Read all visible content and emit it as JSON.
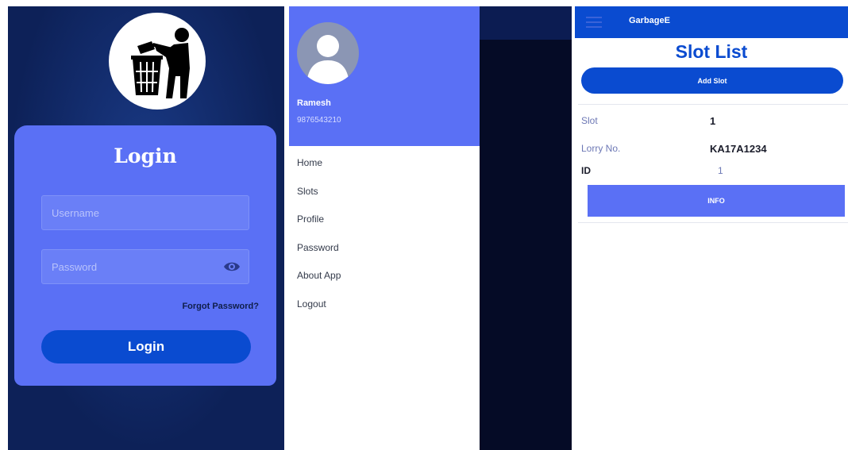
{
  "login": {
    "title": "Login",
    "username_placeholder": "Username",
    "password_placeholder": "Password",
    "forgot_password": "Forgot Password?",
    "login_button": "Login",
    "logo_icon": "trash-bin-person-icon",
    "password_toggle_icon": "eye-icon"
  },
  "drawer": {
    "user_name": "Ramesh",
    "user_phone": "9876543210",
    "avatar_icon": "user-avatar-icon",
    "menu_items": [
      "Home",
      "Slots",
      "Profile",
      "Password",
      "About App",
      "Logout"
    ]
  },
  "slot_list": {
    "app_title": "GarbageE",
    "page_title": "Slot List",
    "add_button": "Add Slot",
    "menu_icon": "hamburger-menu-icon",
    "slot": {
      "slot_label": "Slot",
      "slot_value": "1",
      "lorry_label": "Lorry No.",
      "lorry_value": "KA17A1234",
      "id_label": "ID",
      "id_value": "1",
      "info_button": "INFO"
    }
  },
  "colors": {
    "navy": "#0d2158",
    "primary_blue": "#0a4bd0",
    "periwinkle": "#5a70f5",
    "white": "#ffffff"
  }
}
